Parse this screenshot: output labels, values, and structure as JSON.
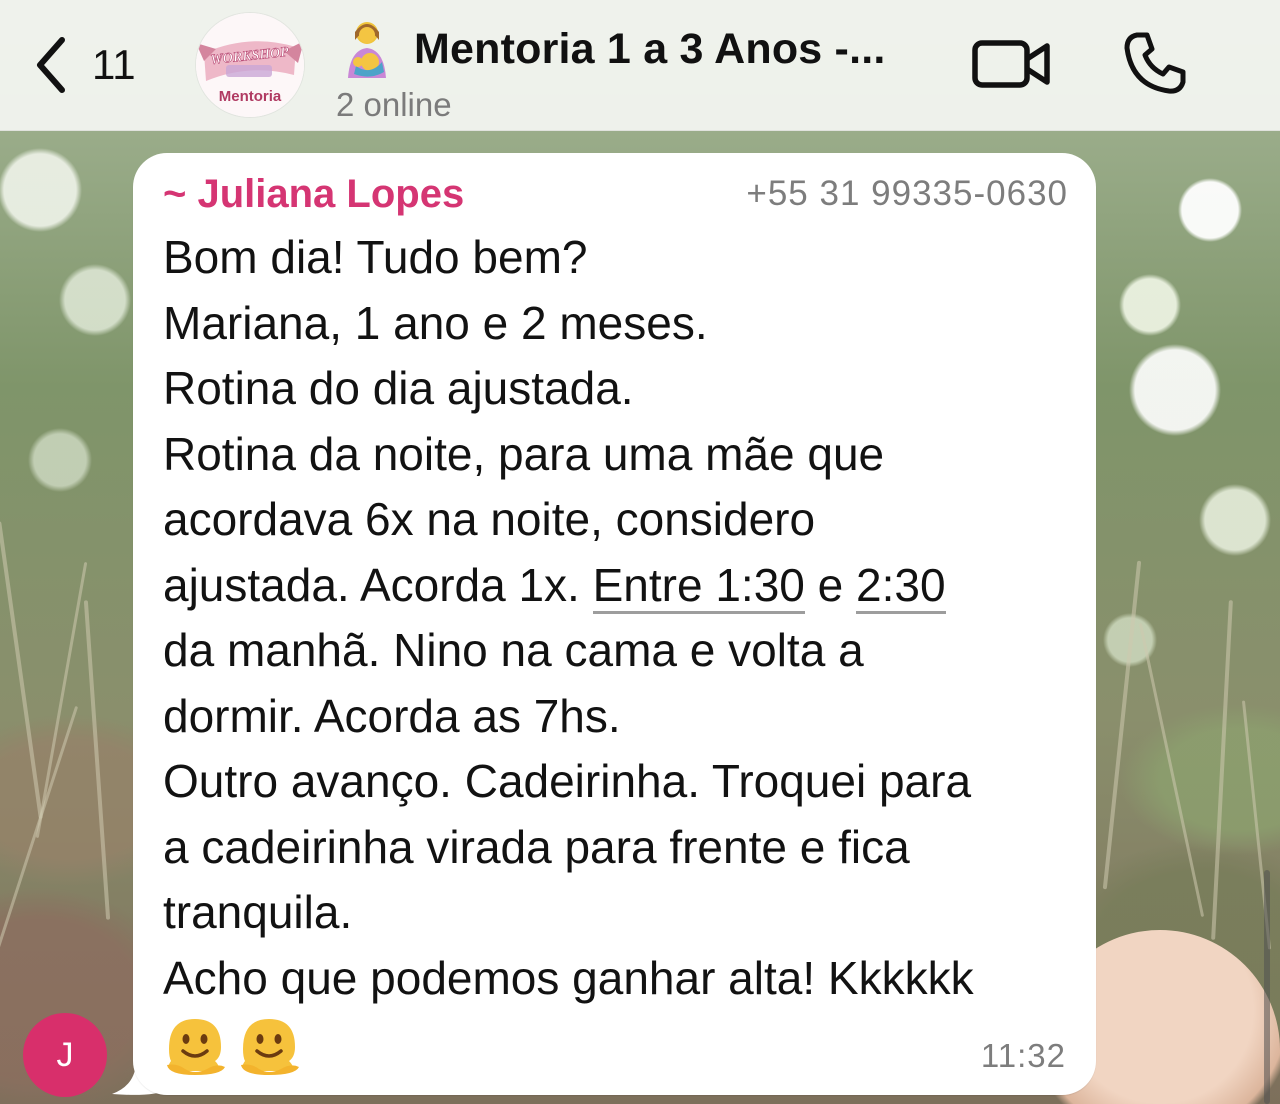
{
  "header": {
    "back_count": "11",
    "group_avatar": {
      "line1": "WORKSHOP",
      "line2": "Mentoria"
    },
    "title": "Mentoria 1 a 3 Anos -...",
    "title_emoji": "breastfeeding-emoji",
    "subtitle": "2 online",
    "icons": [
      "chevron-left-icon",
      "video-call-icon",
      "phone-call-icon"
    ]
  },
  "message": {
    "sender_name": "~ Juliana Lopes",
    "sender_phone": "+55 31 99335-0630",
    "sender_initial": "J",
    "lines": [
      "Bom dia! Tudo bem?",
      "Mariana, 1 ano e 2 meses.",
      "Rotina do dia ajustada.",
      "Rotina da noite, para uma mãe que",
      "acordava 6x na noite, considero"
    ],
    "line6": {
      "before": "ajustada. Acorda 1x. ",
      "link1": "Entre 1:30",
      "middle": " e ",
      "link2": "2:30"
    },
    "lines_after": [
      "da manhã. Nino na cama e volta a",
      "dormir. Acorda as 7hs.",
      "Outro avanço. Cadeirinha. Troquei para",
      "a cadeirinha virada para frente e fica",
      "tranquila.",
      "Acho que podemos ganhar alta! Kkkkkk"
    ],
    "emojis": [
      "melting-face-emoji",
      "melting-face-emoji"
    ],
    "time": "11:32"
  },
  "colors": {
    "sender_name": "#d53573",
    "avatar_bg": "#d82f6b",
    "bubble_bg": "#ffffff",
    "header_bg": "#f4f6f2"
  }
}
